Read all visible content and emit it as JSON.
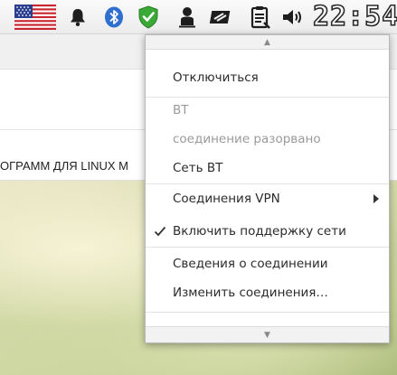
{
  "panel": {
    "clock": "22:54",
    "icons": [
      "us-flag-icon",
      "bell-icon",
      "bluetooth-icon",
      "shield-check-icon",
      "person-icon",
      "network-icon",
      "clipboard-icon",
      "volume-icon"
    ]
  },
  "background_app": {
    "heading": "ОГРАММ ДЛЯ LINUX M"
  },
  "menu": {
    "items": [
      {
        "label": "Отключиться",
        "enabled": true
      },
      {
        "label": "BT",
        "enabled": false
      },
      {
        "label": "соединение разорвано",
        "enabled": false
      },
      {
        "label": "Сеть BT",
        "enabled": true
      },
      {
        "label": "Соединения VPN",
        "enabled": true,
        "submenu": true
      },
      {
        "label": "Включить поддержку сети",
        "enabled": true,
        "checked": true
      },
      {
        "label": "Сведения о соединении",
        "enabled": true
      },
      {
        "label": "Изменить соединения…",
        "enabled": true
      }
    ]
  },
  "colors": {
    "shield_green": "#3aa935",
    "bluetooth_blue": "#2f6fcf",
    "flag_red": "#c8252e",
    "flag_blue": "#2c3f8f"
  }
}
